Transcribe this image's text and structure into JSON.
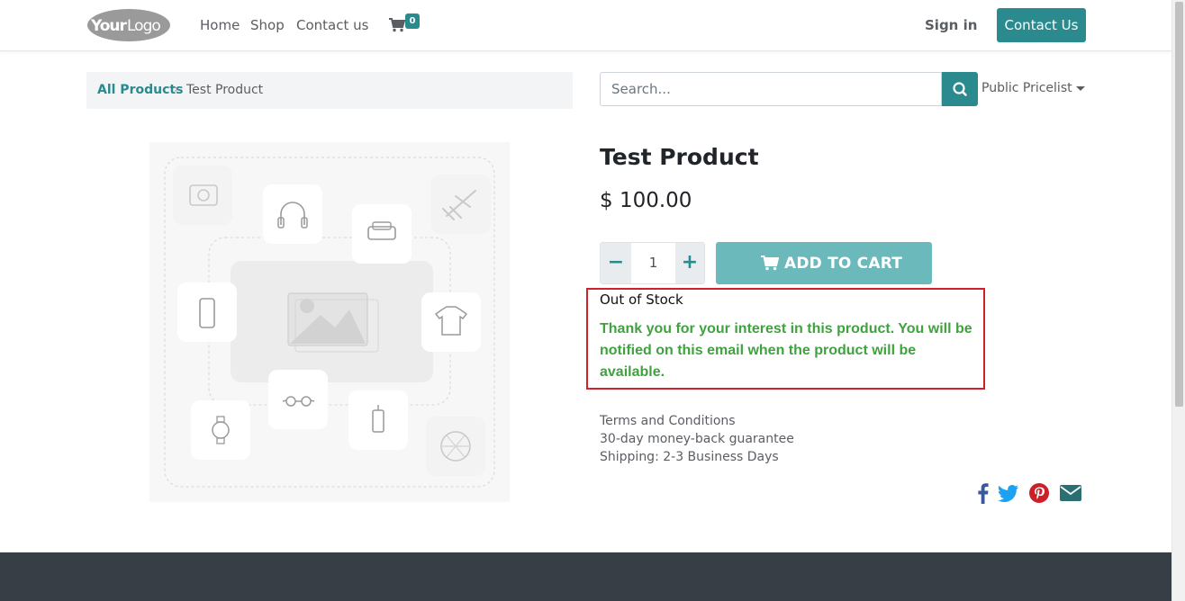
{
  "header": {
    "logo_text": "YourLogo",
    "nav": [
      "Home",
      "Shop",
      "Contact us"
    ],
    "cart_count": "0",
    "sign_in": "Sign in",
    "contact_button": "Contact Us"
  },
  "breadcrumb": {
    "parent": "All Products",
    "separator": "›",
    "current": "Test Product"
  },
  "search": {
    "placeholder": "Search...",
    "pricelist": "Public Pricelist"
  },
  "product": {
    "title": "Test Product",
    "price": "$ 100.00",
    "quantity": "1",
    "minus_label": "−",
    "plus_label": "+",
    "add_to_cart": "ADD TO CART",
    "stock_status": "Out of Stock",
    "stock_message": "Thank you for your interest in this product. You will be notified on this email when the product will be available.",
    "terms": [
      "Terms and Conditions",
      "30-day money-back guarantee",
      "Shipping: 2-3 Business Days"
    ]
  },
  "share_icons": [
    "facebook-icon",
    "twitter-icon",
    "pinterest-icon",
    "envelope-icon"
  ],
  "colors": {
    "primary": "#2a8a8e",
    "add_to_cart": "#6cb9bc",
    "success_text": "#3fa23f",
    "highlight_border": "#d0202b",
    "footer": "#383e45",
    "facebook": "#3b5998",
    "twitter": "#1da1f2",
    "pinterest": "#cb2027",
    "email": "#2a8a8e"
  }
}
